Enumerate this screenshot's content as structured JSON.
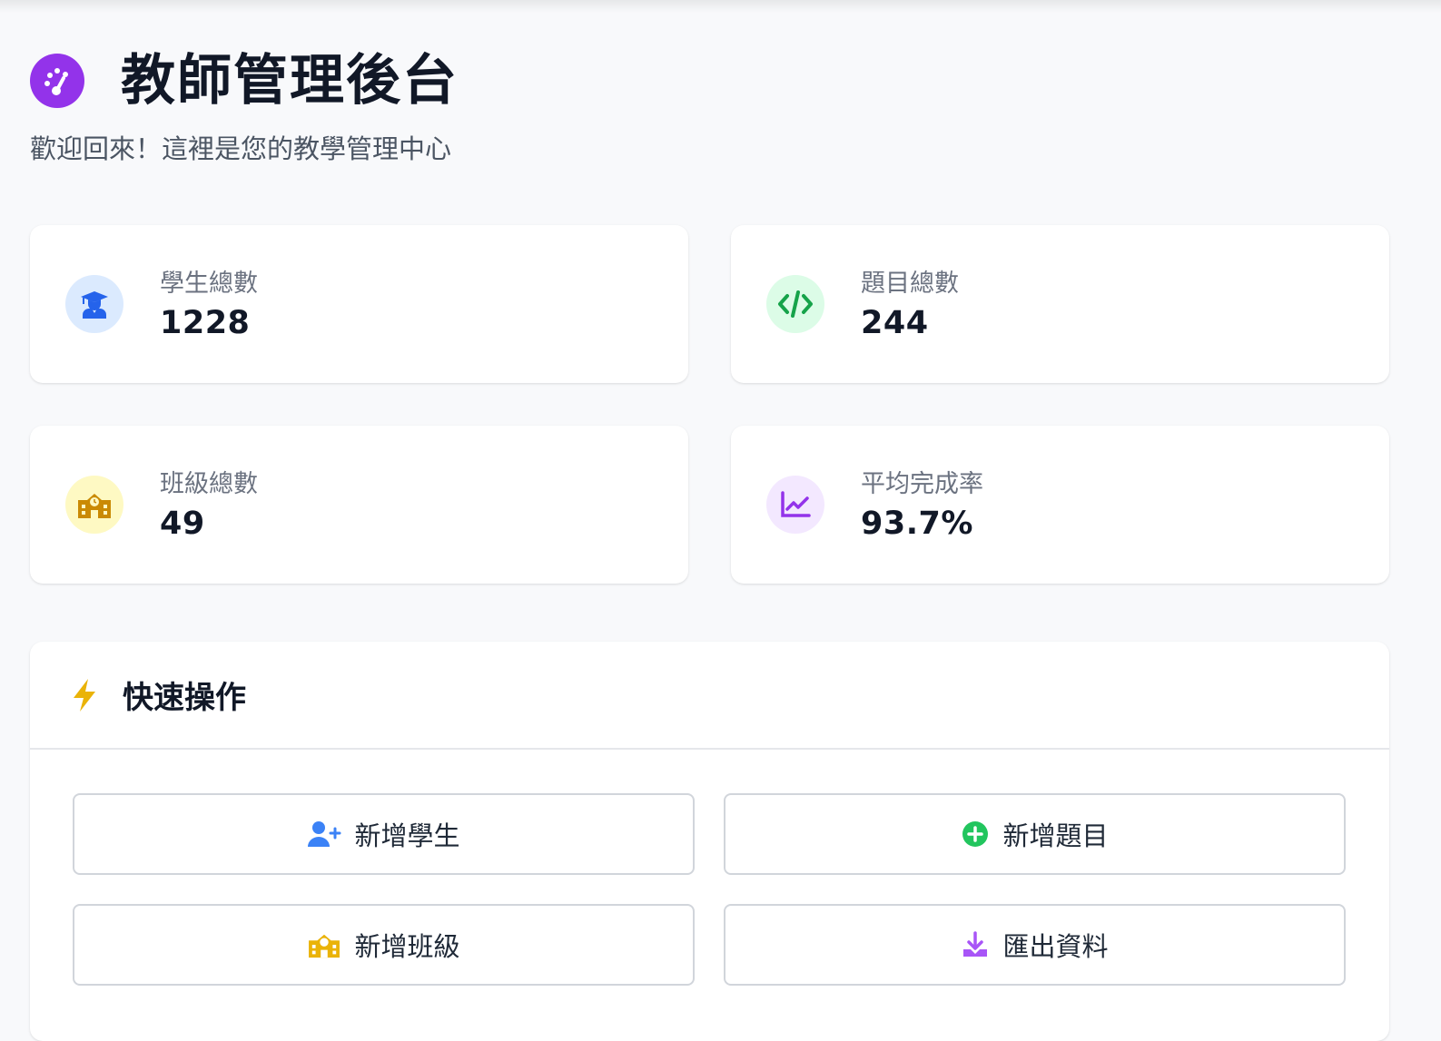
{
  "header": {
    "title": "教師管理後台",
    "subtitle": "歡迎回來！這裡是您的教學管理中心",
    "icon": "dashboard-gauge-icon"
  },
  "stats": [
    {
      "label": "學生總數",
      "value": "1228",
      "icon": "graduate-icon",
      "color": "#2563eb",
      "bg": "#dbeafe"
    },
    {
      "label": "題目總數",
      "value": "244",
      "icon": "code-icon",
      "color": "#16a34a",
      "bg": "#dcfce7"
    },
    {
      "label": "班級總數",
      "value": "49",
      "icon": "school-icon",
      "color": "#ca8a04",
      "bg": "#fef9c3"
    },
    {
      "label": "平均完成率",
      "value": "93.7%",
      "icon": "line-chart-icon",
      "color": "#9333ea",
      "bg": "#f3e8ff"
    }
  ],
  "quick_actions": {
    "title": "快速操作",
    "icon": "bolt-icon",
    "buttons": [
      {
        "label": "新增學生",
        "icon": "user-plus-icon",
        "color": "#3b82f6"
      },
      {
        "label": "新增題目",
        "icon": "plus-circle-icon",
        "color": "#22c55e"
      },
      {
        "label": "新增班級",
        "icon": "school-icon",
        "color": "#eab308"
      },
      {
        "label": "匯出資料",
        "icon": "download-icon",
        "color": "#a855f7"
      }
    ]
  },
  "colors": {
    "accent": "#9333ea",
    "background": "#f8f9fb",
    "bolt": "#eab308"
  }
}
